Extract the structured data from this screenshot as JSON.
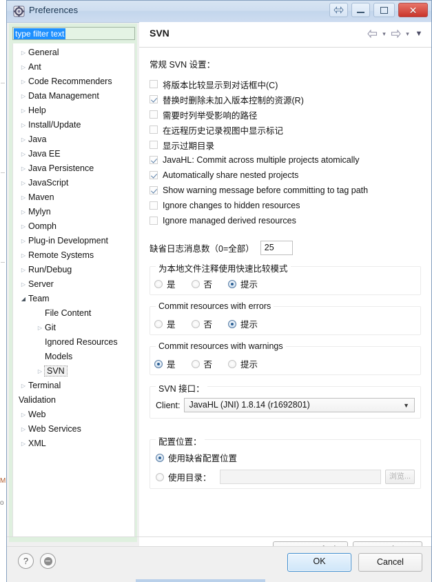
{
  "window": {
    "title": "Preferences",
    "icon": "preferences-gear-icon",
    "buttons": {
      "help_shade": "shade-restore-icon",
      "minimize": "minimize-icon",
      "maximize": "maximize-icon",
      "close": "✕"
    }
  },
  "sidebar": {
    "filter": {
      "value": "type filter text",
      "placeholder": "type filter text"
    },
    "items": [
      {
        "label": "General",
        "level": 1,
        "expandable": true,
        "expanded": false,
        "selected": false
      },
      {
        "label": "Ant",
        "level": 1,
        "expandable": true,
        "expanded": false,
        "selected": false
      },
      {
        "label": "Code Recommenders",
        "level": 1,
        "expandable": true,
        "expanded": false,
        "selected": false
      },
      {
        "label": "Data Management",
        "level": 1,
        "expandable": true,
        "expanded": false,
        "selected": false
      },
      {
        "label": "Help",
        "level": 1,
        "expandable": true,
        "expanded": false,
        "selected": false
      },
      {
        "label": "Install/Update",
        "level": 1,
        "expandable": true,
        "expanded": false,
        "selected": false
      },
      {
        "label": "Java",
        "level": 1,
        "expandable": true,
        "expanded": false,
        "selected": false
      },
      {
        "label": "Java EE",
        "level": 1,
        "expandable": true,
        "expanded": false,
        "selected": false
      },
      {
        "label": "Java Persistence",
        "level": 1,
        "expandable": true,
        "expanded": false,
        "selected": false
      },
      {
        "label": "JavaScript",
        "level": 1,
        "expandable": true,
        "expanded": false,
        "selected": false
      },
      {
        "label": "Maven",
        "level": 1,
        "expandable": true,
        "expanded": false,
        "selected": false
      },
      {
        "label": "Mylyn",
        "level": 1,
        "expandable": true,
        "expanded": false,
        "selected": false
      },
      {
        "label": "Oomph",
        "level": 1,
        "expandable": true,
        "expanded": false,
        "selected": false
      },
      {
        "label": "Plug-in Development",
        "level": 1,
        "expandable": true,
        "expanded": false,
        "selected": false
      },
      {
        "label": "Remote Systems",
        "level": 1,
        "expandable": true,
        "expanded": false,
        "selected": false
      },
      {
        "label": "Run/Debug",
        "level": 1,
        "expandable": true,
        "expanded": false,
        "selected": false
      },
      {
        "label": "Server",
        "level": 1,
        "expandable": true,
        "expanded": false,
        "selected": false
      },
      {
        "label": "Team",
        "level": 1,
        "expandable": true,
        "expanded": true,
        "selected": false
      },
      {
        "label": "File Content",
        "level": 2,
        "expandable": false,
        "expanded": false,
        "selected": false
      },
      {
        "label": "Git",
        "level": 2,
        "expandable": true,
        "expanded": false,
        "selected": false
      },
      {
        "label": "Ignored Resources",
        "level": 2,
        "expandable": false,
        "expanded": false,
        "selected": false
      },
      {
        "label": "Models",
        "level": 2,
        "expandable": false,
        "expanded": false,
        "selected": false
      },
      {
        "label": "SVN",
        "level": 2,
        "expandable": true,
        "expanded": false,
        "selected": true
      },
      {
        "label": "Terminal",
        "level": 1,
        "expandable": true,
        "expanded": false,
        "selected": false
      },
      {
        "label": "Validation",
        "level": 1,
        "expandable": false,
        "expanded": false,
        "selected": false
      },
      {
        "label": "Web",
        "level": 1,
        "expandable": true,
        "expanded": false,
        "selected": false
      },
      {
        "label": "Web Services",
        "level": 1,
        "expandable": true,
        "expanded": false,
        "selected": false
      },
      {
        "label": "XML",
        "level": 1,
        "expandable": true,
        "expanded": false,
        "selected": false
      }
    ]
  },
  "page": {
    "title": "SVN",
    "nav": {
      "back_icon": "arrow-left-icon",
      "back_caret": "▾",
      "forward_icon": "arrow-right-icon",
      "forward_caret": "▾",
      "menu_caret": "▼"
    },
    "section_label": "常规 SVN 设置：",
    "checkboxes": [
      {
        "label": "将版本比较显示到对话框中(C)",
        "checked": false
      },
      {
        "label": "替换时删除未加入版本控制的资源(R)",
        "checked": true
      },
      {
        "label": "需要时列举受影响的路径",
        "checked": false
      },
      {
        "label": "在远程历史记录视图中显示标记",
        "checked": false
      },
      {
        "label": "显示过期目录",
        "checked": false
      },
      {
        "label": "JavaHL: Commit across multiple projects atomically",
        "checked": true
      },
      {
        "label": "Automatically share nested projects",
        "checked": true
      },
      {
        "label": "Show warning message before committing to tag path",
        "checked": true
      },
      {
        "label": "Ignore changes to hidden resources",
        "checked": false
      },
      {
        "label": "Ignore managed derived resources",
        "checked": false
      }
    ],
    "log_messages": {
      "label": "缺省日志消息数（0=全部）",
      "value": "25"
    },
    "radio_groups": [
      {
        "legend": "为本地文件注释使用快速比较模式",
        "options": [
          {
            "label": "是",
            "selected": false
          },
          {
            "label": "否",
            "selected": false
          },
          {
            "label": "提示",
            "selected": true
          }
        ]
      },
      {
        "legend": "Commit resources with errors",
        "options": [
          {
            "label": "是",
            "selected": false
          },
          {
            "label": "否",
            "selected": false
          },
          {
            "label": "提示",
            "selected": true
          }
        ]
      },
      {
        "legend": "Commit resources with warnings",
        "options": [
          {
            "label": "是",
            "selected": true
          },
          {
            "label": "否",
            "selected": false
          },
          {
            "label": "提示",
            "selected": false
          }
        ]
      }
    ],
    "svn_interface": {
      "legend": "SVN 接口：",
      "client_label": "Client:",
      "client_value": "JavaHL (JNI) 1.8.14 (r1692801)",
      "caret": "▼"
    },
    "config_location": {
      "legend": "配置位置：",
      "default_option": {
        "label": "使用缺省配置位置",
        "selected": true
      },
      "dir_option": {
        "label": "使用目录：",
        "selected": false
      },
      "dir_value": "",
      "browse_label": "浏览..."
    }
  },
  "footer": {
    "restore_defaults": "Restore Defaults",
    "apply": "Apply",
    "help_icon": "?",
    "secondary_icon": "no-entry-icon",
    "ok": "OK",
    "cancel": "Cancel"
  }
}
